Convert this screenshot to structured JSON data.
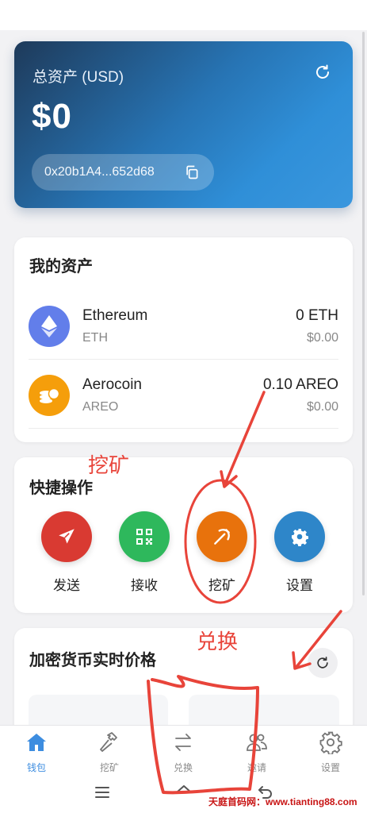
{
  "balance": {
    "label": "总资产 (USD)",
    "value": "$0",
    "address": "0x20b1A4...652d68"
  },
  "assets": {
    "title": "我的资产",
    "items": [
      {
        "name": "Ethereum",
        "symbol": "ETH",
        "amount": "0 ETH",
        "usd": "$0.00",
        "color": "#627eea",
        "icon": "ethereum-icon"
      },
      {
        "name": "Aerocoin",
        "symbol": "AREO",
        "amount": "0.10 AREO",
        "usd": "$0.00",
        "color": "#f59e0b",
        "icon": "coin-stack-icon"
      }
    ]
  },
  "quick_actions": {
    "title": "快捷操作",
    "items": [
      {
        "label": "发送",
        "color": "#d93a32",
        "icon": "send-icon"
      },
      {
        "label": "接收",
        "color": "#2eb85c",
        "icon": "qrcode-icon"
      },
      {
        "label": "挖矿",
        "color": "#e8720c",
        "icon": "pickaxe-icon"
      },
      {
        "label": "设置",
        "color": "#2e86c9",
        "icon": "gear-icon"
      }
    ]
  },
  "prices": {
    "title": "加密货币实时价格"
  },
  "nav": {
    "items": [
      {
        "label": "钱包",
        "icon": "home-icon",
        "active": true
      },
      {
        "label": "挖矿",
        "icon": "hammer-icon",
        "active": false
      },
      {
        "label": "兑换",
        "icon": "swap-icon",
        "active": false
      },
      {
        "label": "邀请",
        "icon": "users-icon",
        "active": false
      },
      {
        "label": "设置",
        "icon": "gear-icon",
        "active": false
      }
    ]
  },
  "annotations": {
    "mining": "挖矿",
    "exchange": "兑换"
  },
  "watermark": "天庭首码网：www.tianting88.com",
  "colors": {
    "accent": "#3d8de0",
    "annotation": "#e8443a"
  }
}
